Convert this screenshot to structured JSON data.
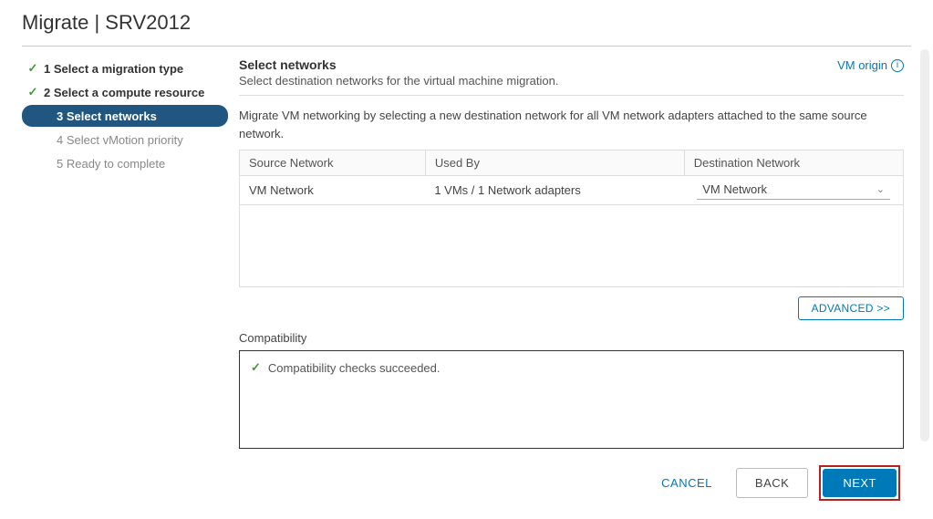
{
  "dialog": {
    "title": "Migrate | SRV2012"
  },
  "wizard": {
    "steps": [
      {
        "label": "1 Select a migration type",
        "state": "done"
      },
      {
        "label": "2 Select a compute resource",
        "state": "done"
      },
      {
        "label": "3 Select networks",
        "state": "active"
      },
      {
        "label": "4 Select vMotion priority",
        "state": "future"
      },
      {
        "label": "5 Ready to complete",
        "state": "future"
      }
    ]
  },
  "main": {
    "section_title": "Select networks",
    "vm_origin_label": "VM origin",
    "subtext": "Select destination networks for the virtual machine migration.",
    "description": "Migrate VM networking by selecting a new destination network for all VM network adapters attached to the same source network.",
    "table": {
      "headers": {
        "source": "Source Network",
        "used_by": "Used By",
        "destination": "Destination Network"
      },
      "rows": [
        {
          "source": "VM Network",
          "used_by": "1 VMs / 1 Network adapters",
          "destination": "VM Network"
        }
      ]
    },
    "advanced_label": "ADVANCED >>",
    "compatibility_label": "Compatibility",
    "compatibility_status": "Compatibility checks succeeded."
  },
  "footer": {
    "cancel": "CANCEL",
    "back": "BACK",
    "next": "NEXT"
  }
}
